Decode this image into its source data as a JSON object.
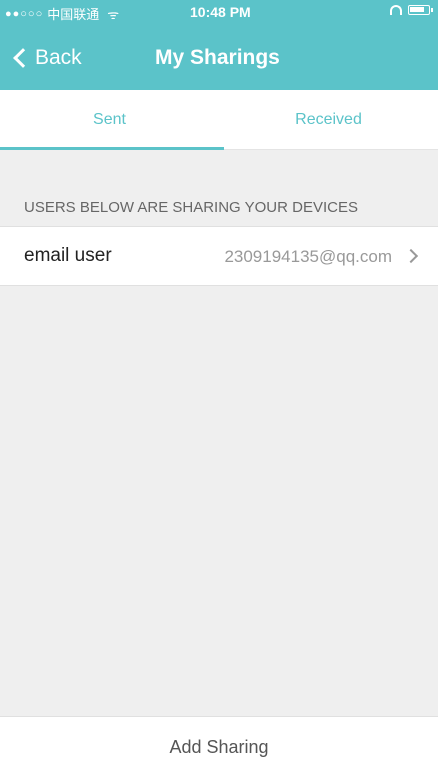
{
  "status_bar": {
    "signal": "●●○○○",
    "carrier": "中国联通",
    "wifi": "ᯤ",
    "time": "10:48 PM",
    "icons": [
      "signal-icon",
      "wifi-icon",
      "headphone-icon",
      "battery-icon"
    ]
  },
  "nav": {
    "back_label": "Back",
    "title": "My Sharings"
  },
  "tabs": [
    {
      "label": "Sent",
      "active": true
    },
    {
      "label": "Received",
      "active": false
    }
  ],
  "section": {
    "header": "USERS BELOW ARE SHARING YOUR DEVICES",
    "rows": [
      {
        "label": "email user",
        "value": "2309194135@qq.com"
      }
    ]
  },
  "footer": {
    "add_label": "Add Sharing"
  },
  "colors": {
    "accent": "#5bc3c9",
    "background": "#efefef"
  }
}
